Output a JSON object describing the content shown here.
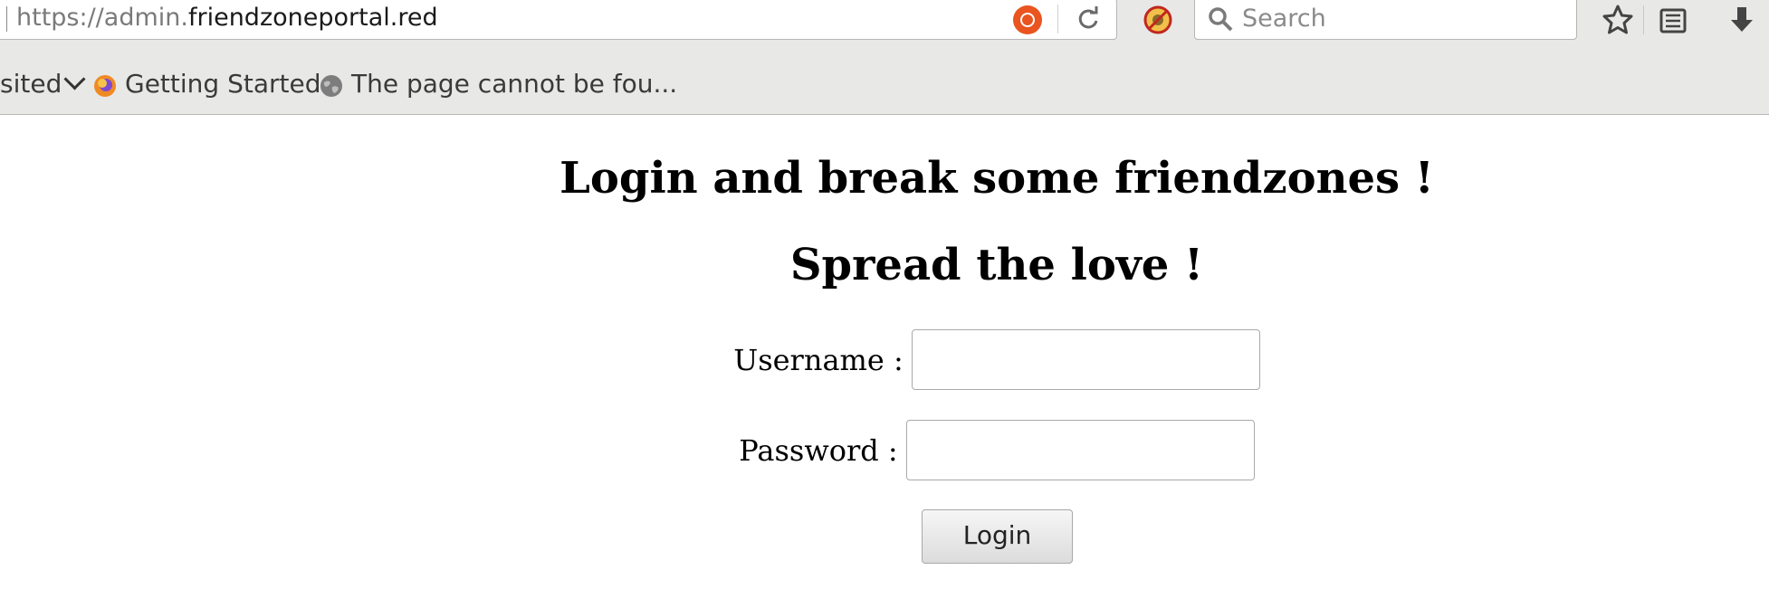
{
  "browser": {
    "url": {
      "prefix": "https://admin.",
      "domain": "friendzoneportal.red"
    },
    "search": {
      "placeholder": "Search"
    },
    "bookmarks": {
      "most_visited_partial": "sited",
      "items": [
        {
          "label": "Getting Started",
          "icon": "firefox-icon"
        },
        {
          "label": "The page cannot be fou...",
          "icon": "globe-icon"
        }
      ]
    },
    "icons": {
      "ubuntu_color": "#e9541f",
      "blocker_color": "#c0281f"
    }
  },
  "page": {
    "heading1": "Login and break some friendzones !",
    "heading2": "Spread the love !",
    "username_label": "Username :",
    "username_value": "",
    "password_label": "Password :",
    "password_value": "",
    "login_button": "Login"
  }
}
